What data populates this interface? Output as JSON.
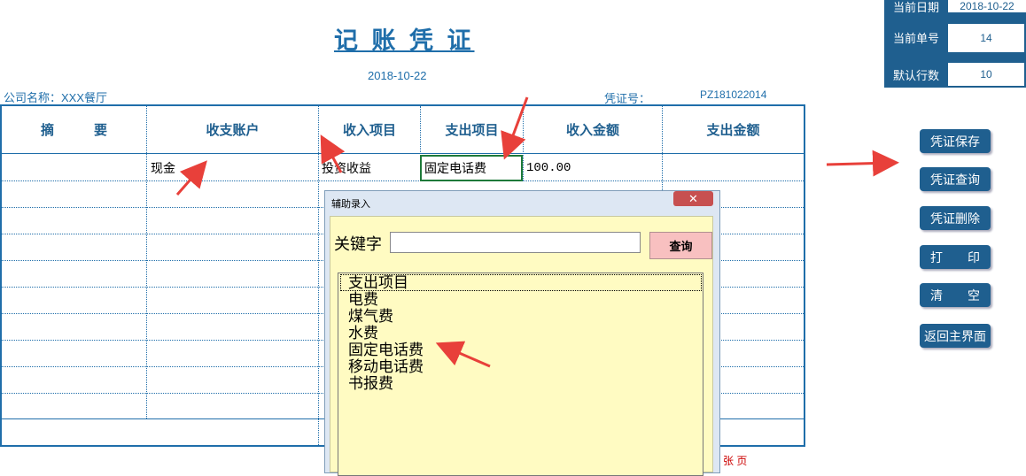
{
  "title": "记 账 凭 证",
  "date": "2018-10-22",
  "company": "公司名称：XXX餐厅",
  "voucher_label": "凭证号：",
  "voucher_no": "PZ181022014",
  "info": {
    "current_date_label": "当前日期",
    "current_date_value": "2018-10-22",
    "current_no_label": "当前单号",
    "current_no_value": "14",
    "default_rows_label": "默认行数",
    "default_rows_value": "10"
  },
  "table": {
    "headers": [
      "摘　　　要",
      "收支账户",
      "收入项目",
      "支出项目",
      "收入金额",
      "支出金额"
    ],
    "row1": {
      "summary": "",
      "account": "现金",
      "income_item": "投资收益",
      "expense_item": "固定电话费",
      "income_amount": "100.00",
      "expense_amount": ""
    }
  },
  "buttons": {
    "save": "凭证保存",
    "query": "凭证查询",
    "delete": "凭证删除",
    "print": "打　　印",
    "clear": "清　　空",
    "back": "返回主界面"
  },
  "dialog": {
    "title": "辅助录入",
    "keyword_label": "关键字",
    "keyword_value": "",
    "query_button": "查询",
    "close": "✕",
    "items": [
      "支出项目",
      "电费",
      "煤气费",
      "水费",
      "固定电话费",
      "移动电话费",
      "书报费"
    ]
  },
  "bottom_fragment": "张 页",
  "colors": {
    "accent": "#1f6eaa",
    "panel": "#1f5f8f",
    "arrow": "#e8403a"
  }
}
